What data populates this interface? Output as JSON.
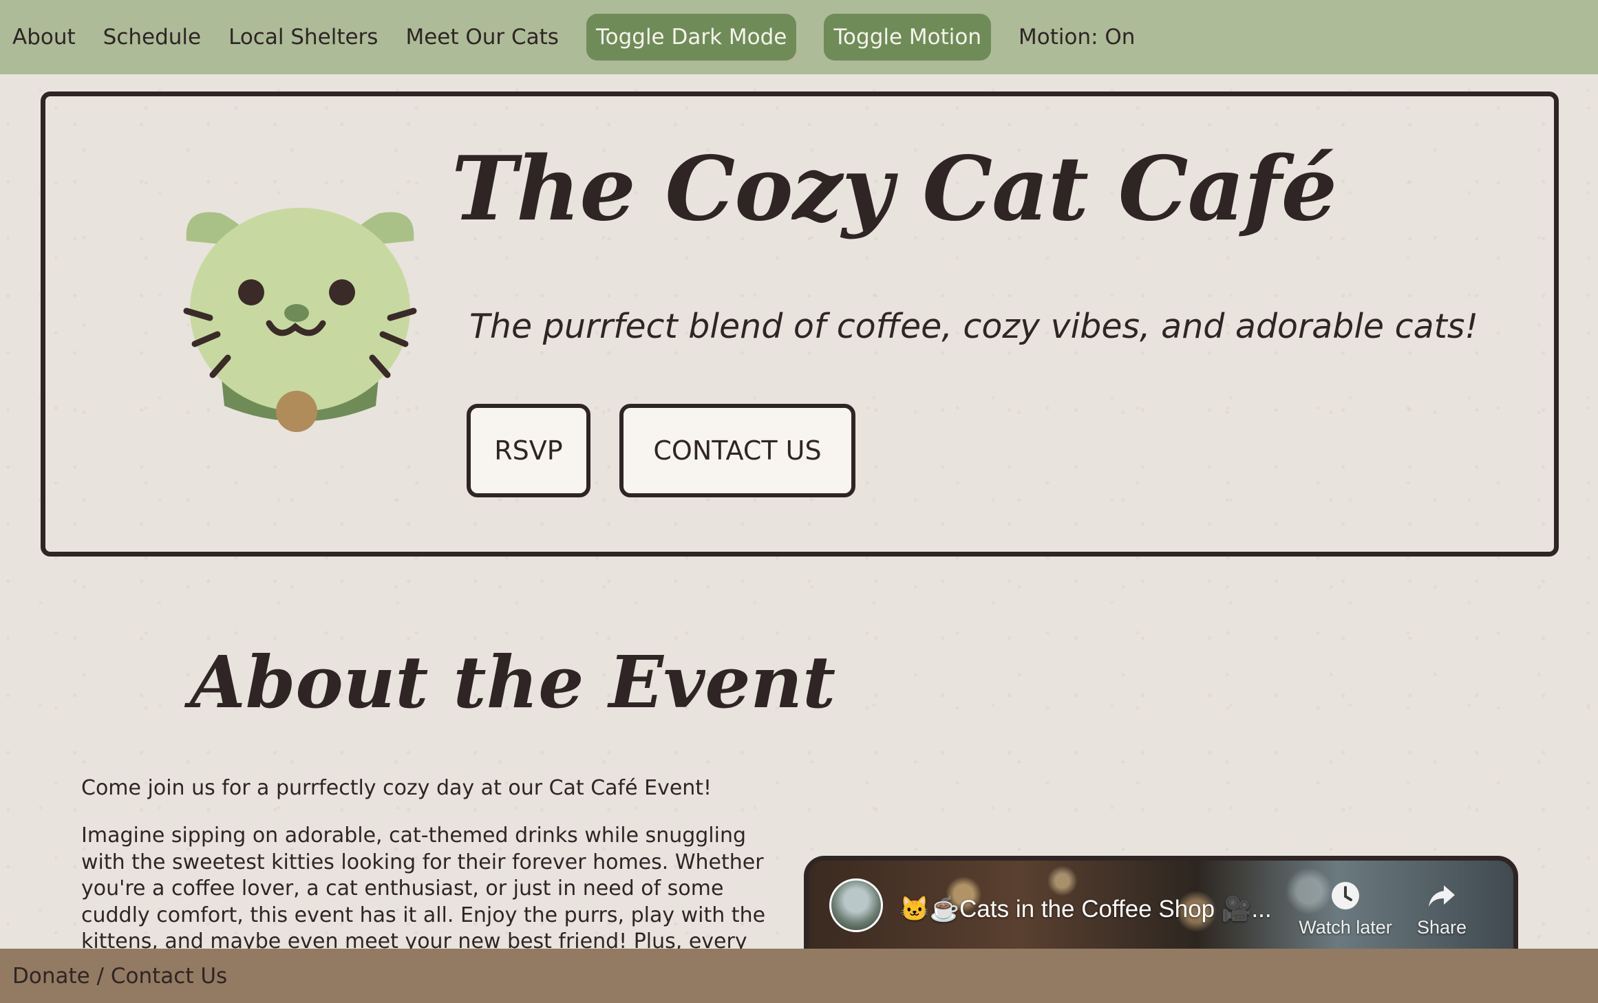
{
  "nav": {
    "links": [
      "About",
      "Schedule",
      "Local Shelters",
      "Meet Our Cats"
    ],
    "toggle_dark_label": "Toggle Dark Mode",
    "toggle_motion_label": "Toggle Motion",
    "motion_status": "Motion: On"
  },
  "hero": {
    "title": "The Cozy Cat Café",
    "subtitle": "The purrfect blend of coffee, cozy vibes, and adorable cats!",
    "rsvp_label": "RSVP",
    "contact_label": "CONTACT US"
  },
  "about": {
    "title": "About the Event",
    "intro": "Come join us for a purrfectly cozy day at our Cat Café Event!",
    "body": "Imagine sipping on adorable, cat-themed drinks while snuggling with the sweetest kitties looking for their forever homes. Whether you're a coffee lover, a cat enthusiast, or just in need of some cuddly comfort, this event has it all. Enjoy the purrs, play with the kittens, and maybe even meet your new best friend! Plus, every sip helps support our furry friends"
  },
  "video": {
    "title": "🐱☕Cats in the Coffee Shop 🎥...",
    "watch_later": "Watch later",
    "share": "Share"
  },
  "footer": {
    "link": "Donate / Contact Us"
  },
  "colors": {
    "nav_bg": "#adbb98",
    "nav_button": "#6f8c58",
    "page_bg": "#e9e3de",
    "ink": "#2e2524",
    "footer_bg": "#937a62",
    "cat_face": "#c7d9a0",
    "cat_collar": "#6f8c58",
    "cat_bell": "#b08c5a"
  },
  "icons": [
    "cat-mascot-icon",
    "clock-icon",
    "share-arrow-icon"
  ]
}
